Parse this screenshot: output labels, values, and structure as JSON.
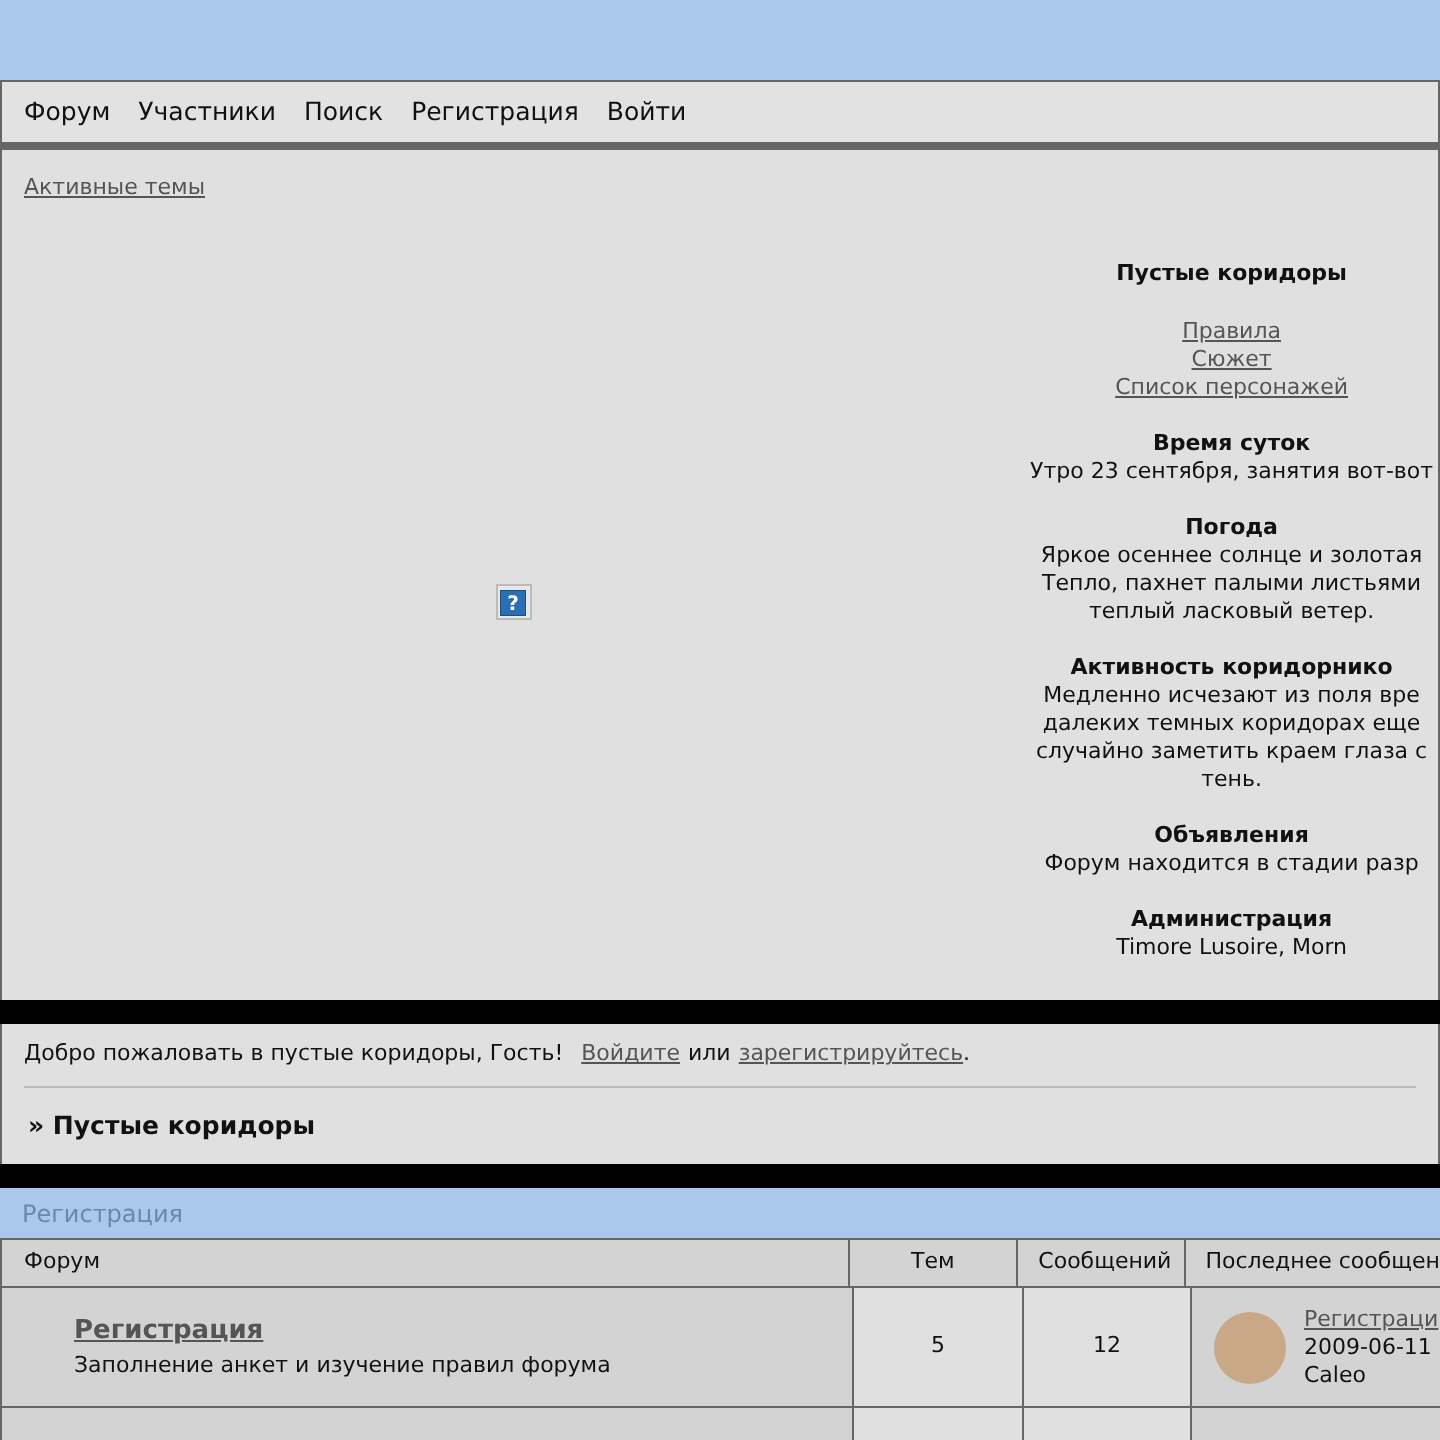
{
  "nav": [
    {
      "label": "Форум"
    },
    {
      "label": "Участники"
    },
    {
      "label": "Поиск"
    },
    {
      "label": "Регистрация"
    },
    {
      "label": "Войти"
    }
  ],
  "active_topics": "Активные темы",
  "help_icon": "?",
  "info": {
    "title": "Пустые коридоры",
    "links": [
      "Правила",
      "Сюжет",
      "Список персонажей"
    ],
    "sections": [
      {
        "heading": "Время суток",
        "lines": [
          "Утро 23 сентября, занятия вот-вот"
        ]
      },
      {
        "heading": "Погода",
        "lines": [
          "Яркое осеннее солнце и золотая",
          "Тепло, пахнет палыми листьями",
          "теплый ласковый ветер."
        ]
      },
      {
        "heading": "Активность коридорнико",
        "lines": [
          "Медленно исчезают из поля вре",
          "далеких темных коридорах еще",
          "случайно заметить краем глаза с",
          "тень."
        ]
      },
      {
        "heading": "Объявления",
        "lines": [
          "Форум находится в стадии разр"
        ]
      },
      {
        "heading": "Администрация",
        "lines": [
          "Timore Lusoire, Morn"
        ]
      }
    ]
  },
  "welcome": {
    "text": "Добро пожаловать в пустые коридоры, Гость!",
    "login": "Войдите",
    "or": "или",
    "register": "зарегистрируйтесь",
    "end": "."
  },
  "crumb": "» Пустые коридоры",
  "category": {
    "title": "Регистрация",
    "columns": [
      "Форум",
      "Тем",
      "Сообщений",
      "Последнее сообщен"
    ],
    "rows": [
      {
        "name": "Регистрация",
        "description": "Заполнение анкет и изучение правил форума",
        "topics": "5",
        "posts": "12",
        "last_title": "Регистраци",
        "last_date": "2009-06-11",
        "last_author": "Caleo"
      }
    ]
  }
}
